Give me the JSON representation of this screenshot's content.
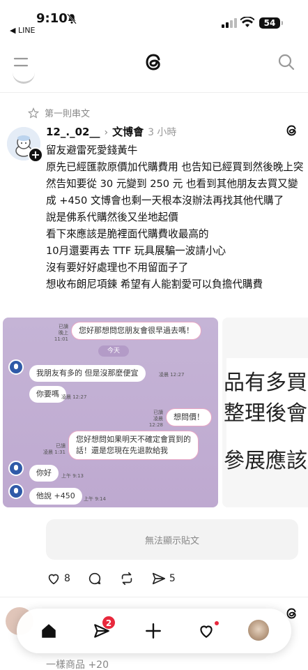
{
  "status_bar": {
    "time": "9:10",
    "back_app": "◀ LINE",
    "battery": "54"
  },
  "header": {
    "menu_icon": "menu-icon",
    "logo_icon": "threads-logo-icon",
    "search_icon": "search-icon"
  },
  "post": {
    "pinned_label": "第一則串文",
    "username": "12_._02__",
    "topic": "文博會",
    "time_ago": "3 小時",
    "body": "留友避雷死愛錢黃牛\n原先已經匯款原價加代購費用 也告知已經買到然後晚上突然告知要從 30 元變到 250 元 也看到其他朋友去買又變成 +450 文博會也剩一天根本沒辦法再找其他代購了\n說是佛系代購然後又坐地起價\n看下來應該是脆裡面代購費收最高的\n10月還要再去 TTF 玩具展騙一波請小心\n沒有要好好處理也不用留面子了\n想收布朗尼項鍊 希望有人能割愛可以負擔代購費",
    "unavailable_text": "無法顯示貼文",
    "likes": "8",
    "shares": "5"
  },
  "chat_image": {
    "day_label": "今天",
    "messages": [
      {
        "side": "right",
        "text": "您好那想問您朋友會很早過去嗎！",
        "meta1": "已讀",
        "meta2": "晚上 11:01"
      },
      {
        "side": "left",
        "text": "我朋友有多的 但是沒那麼便宜",
        "meta1": "凌晨 12:27"
      },
      {
        "side": "left",
        "text": "你要嗎",
        "meta1": "凌晨 12:27"
      },
      {
        "side": "right",
        "text": "想問價！",
        "meta1": "已讀",
        "meta2": "凌晨 12:28"
      },
      {
        "side": "right",
        "text": "您好想問如果明天不確定會買到的",
        "text2": "話！還是您現在先退款給我",
        "meta1": "已讀",
        "meta2": "凌晨 1:31"
      },
      {
        "side": "left",
        "text": "你好",
        "meta1": "上午 9:13"
      },
      {
        "side": "left",
        "text": "他說 +450",
        "meta1": "上午 9:14"
      }
    ]
  },
  "text_image": {
    "lines": [
      "品有多買",
      "整理後會",
      "參展應該"
    ]
  },
  "next_post": {
    "text": "一樣商品 +20"
  },
  "nav": {
    "home": "home-icon",
    "activity_badge": "2"
  },
  "colors": {
    "chat_bg": "#c5b4d6",
    "accent_red": "#e8283c",
    "bubble_border": "#e9a6c4"
  }
}
